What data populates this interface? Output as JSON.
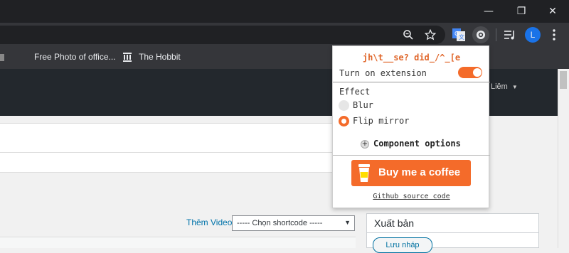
{
  "window": {
    "minimize_icon": "—",
    "restore_icon": "❐",
    "close_icon": "✕"
  },
  "toolbar": {
    "profile_initial": "L"
  },
  "bookmarks": [
    {
      "label": "Free Photo of office..."
    },
    {
      "label": "The Hobbit"
    }
  ],
  "page": {
    "user_menu": "Liêm",
    "add_video_link": "Thêm Video",
    "shortcode_select": "----- Chọn shortcode -----",
    "publish_title": "Xuất bản",
    "save_draft": "Lưu nháp"
  },
  "popup": {
    "title": "jh\\t__se? did_/^_[e",
    "turn_on_label": "Turn on extension",
    "turn_on_state": true,
    "effect_label": "Effect",
    "effects": [
      {
        "label": "Blur",
        "selected": false
      },
      {
        "label": "Flip mirror",
        "selected": true
      }
    ],
    "component_options": "Component options",
    "coffee_button": "Buy me a coffee",
    "github_link": "Github source code"
  },
  "colors": {
    "accent": "#f46b2a",
    "title_color": "#e0662a",
    "chrome_dark": "#202124",
    "chrome_toolbar": "#35363a",
    "wp_dark": "#23282d",
    "wp_link": "#0073aa"
  }
}
